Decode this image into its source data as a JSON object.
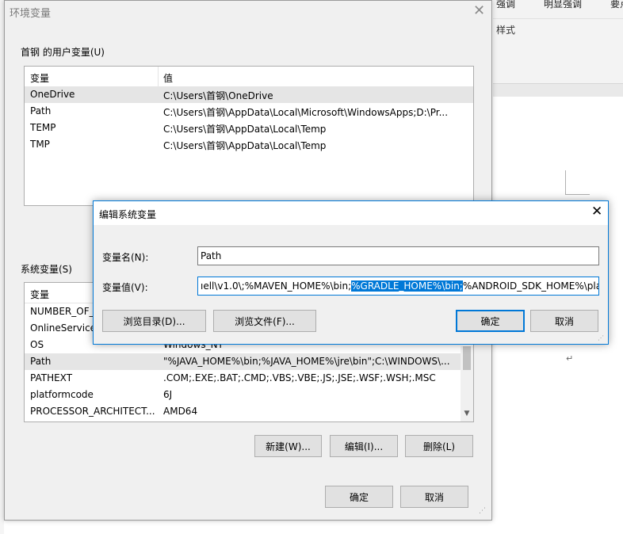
{
  "background_app": {
    "style_labels": [
      "强调",
      "明显强调",
      "要点"
    ],
    "group_label": "样式",
    "paragraph_mark": "↵"
  },
  "env_window": {
    "title": "环境变量",
    "user_group": {
      "label": "首钢 的用户变量(U)",
      "columns": [
        "变量",
        "值"
      ],
      "rows": [
        {
          "name": "OneDrive",
          "value": "C:\\Users\\首钢\\OneDrive"
        },
        {
          "name": "Path",
          "value": "C:\\Users\\首钢\\AppData\\Local\\Microsoft\\WindowsApps;D:\\Pr..."
        },
        {
          "name": "TEMP",
          "value": "C:\\Users\\首钢\\AppData\\Local\\Temp"
        },
        {
          "name": "TMP",
          "value": "C:\\Users\\首钢\\AppData\\Local\\Temp"
        }
      ]
    },
    "system_group": {
      "label": "系统变量(S)",
      "columns": [
        "变量",
        "值"
      ],
      "rows": [
        {
          "name": "NUMBER_OF_",
          "value": ""
        },
        {
          "name": "OnlineService",
          "value": ""
        },
        {
          "name": "OS",
          "value": "Windows_NT"
        },
        {
          "name": "Path",
          "value": "\"%JAVA_HOME%\\bin;%JAVA_HOME%\\jre\\bin\";C:\\WINDOWS\\..."
        },
        {
          "name": "PATHEXT",
          "value": ".COM;.EXE;.BAT;.CMD;.VBS;.VBE;.JS;.JSE;.WSF;.WSH;.MSC"
        },
        {
          "name": "platformcode",
          "value": "6J"
        },
        {
          "name": "PROCESSOR_ARCHITECT...",
          "value": "AMD64"
        }
      ],
      "buttons": {
        "new": "新建(W)...",
        "edit": "编辑(I)...",
        "delete": "删除(L)"
      }
    },
    "ok_label": "确定",
    "cancel_label": "取消"
  },
  "edit_dialog": {
    "title": "编辑系统变量",
    "name_label": "变量名(N):",
    "name_value": "Path",
    "value_label": "变量值(V):",
    "value_before": "ıell\\v1.0\\;%MAVEN_HOME%\\bin;",
    "value_selected": "%GRADLE_HOME%\\bin;",
    "value_after": "%ANDROID_SDK_HOME%\\pla",
    "browse_dir_label": "浏览目录(D)...",
    "browse_file_label": "浏览文件(F)...",
    "ok_label": "确定",
    "cancel_label": "取消"
  }
}
